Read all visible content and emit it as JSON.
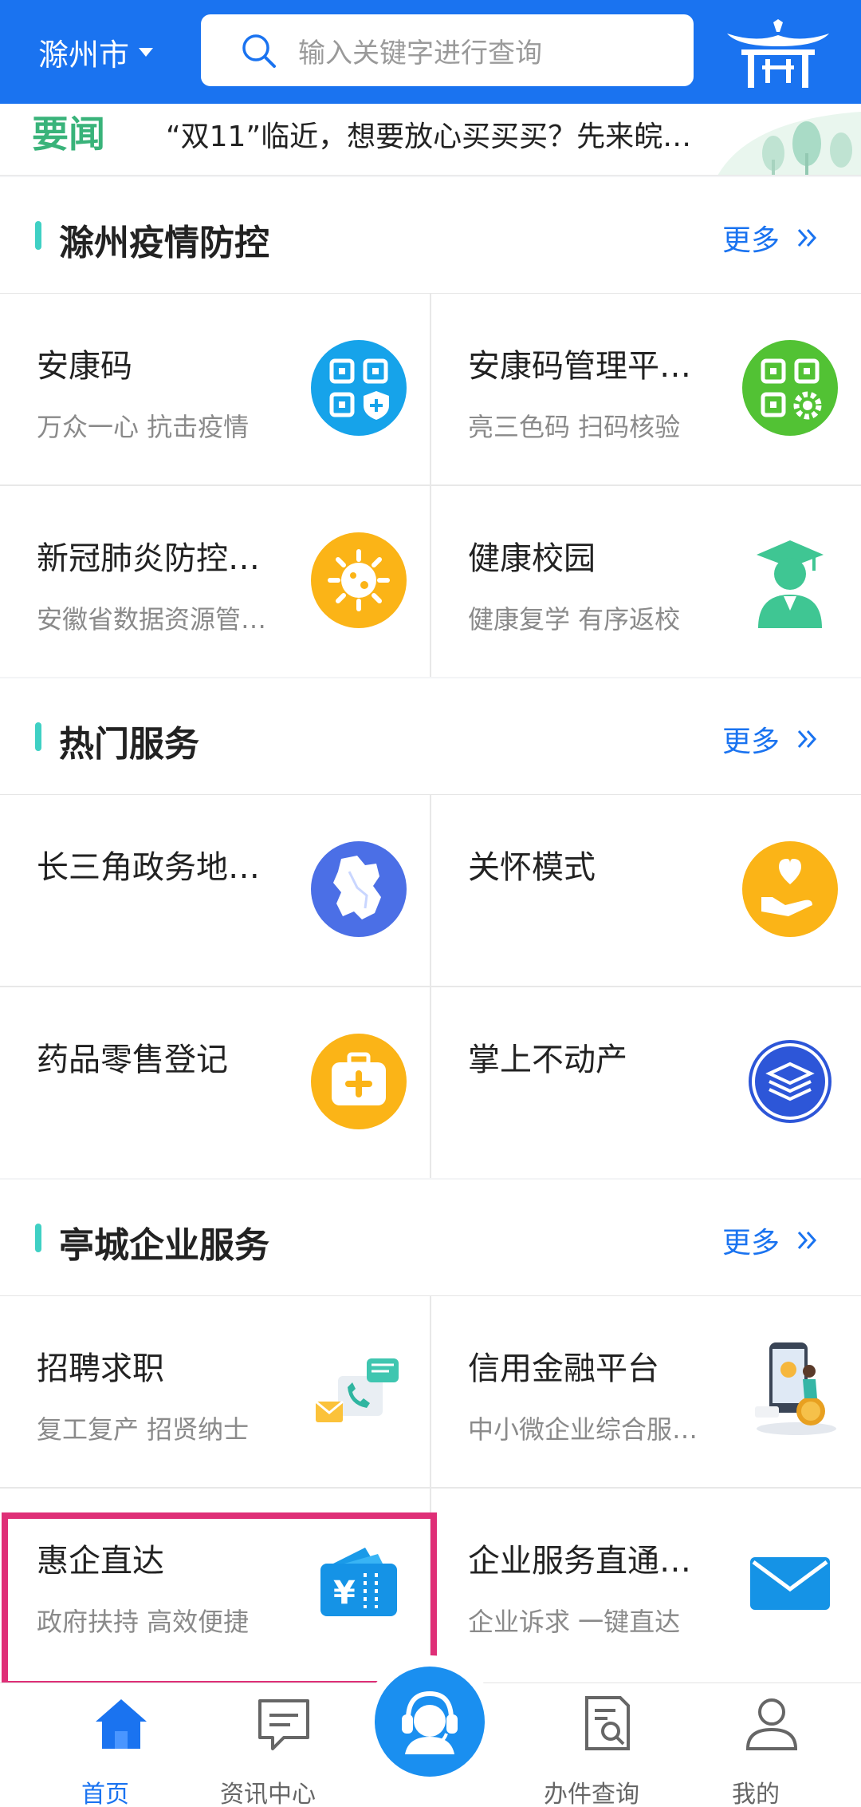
{
  "header": {
    "city": "滁州市",
    "search_placeholder": "输入关键字进行查询"
  },
  "ticker": {
    "tag": "要闻",
    "text": "“双11”临近，想要放心买买买？先来皖…"
  },
  "sections": [
    {
      "title": "滁州疫情防控",
      "more": "更多",
      "items": [
        {
          "name": "安康码",
          "sub": "万众一心 抗击疫情",
          "icon": "qr-shield-icon"
        },
        {
          "name": "安康码管理平…",
          "sub": "亮三色码 扫码核验",
          "icon": "qr-gear-icon"
        },
        {
          "name": "新冠肺炎防控…",
          "sub": "安徽省数据资源管…",
          "icon": "virus-icon"
        },
        {
          "name": "健康校园",
          "sub": "健康复学 有序返校",
          "icon": "graduate-icon"
        }
      ]
    },
    {
      "title": "热门服务",
      "more": "更多",
      "items": [
        {
          "name": "长三角政务地…",
          "sub": "",
          "icon": "map-icon"
        },
        {
          "name": "关怀模式",
          "sub": "",
          "icon": "care-heart-icon"
        },
        {
          "name": "药品零售登记",
          "sub": "",
          "icon": "medkit-icon"
        },
        {
          "name": "掌上不动产",
          "sub": "",
          "icon": "real-estate-icon"
        }
      ]
    },
    {
      "title": "亭城企业服务",
      "more": "更多",
      "items": [
        {
          "name": "招聘求职",
          "sub": "复工复产 招贤纳士",
          "icon": "recruit-icon"
        },
        {
          "name": "信用金融平台",
          "sub": "中小微企业综合服…",
          "icon": "credit-finance-icon"
        },
        {
          "name": "惠企直达",
          "sub": "政府扶持 高效便捷",
          "icon": "wallet-yuan-icon"
        },
        {
          "name": "企业服务直通…",
          "sub": "企业诉求 一键直达",
          "icon": "mail-icon"
        }
      ]
    }
  ],
  "nav": [
    {
      "label": "首页",
      "icon": "home-icon",
      "active": true
    },
    {
      "label": "资讯中心",
      "icon": "message-icon",
      "active": false
    },
    {
      "label": "",
      "icon": "customer-service-icon",
      "active": false
    },
    {
      "label": "办件查询",
      "icon": "doc-search-icon",
      "active": false
    },
    {
      "label": "我的",
      "icon": "user-icon",
      "active": false
    }
  ],
  "colors": {
    "brand_blue": "#1a73f0",
    "accent_teal": "#3fd0c4",
    "news_green": "#39b37a",
    "highlight_pink": "#df2f77"
  }
}
